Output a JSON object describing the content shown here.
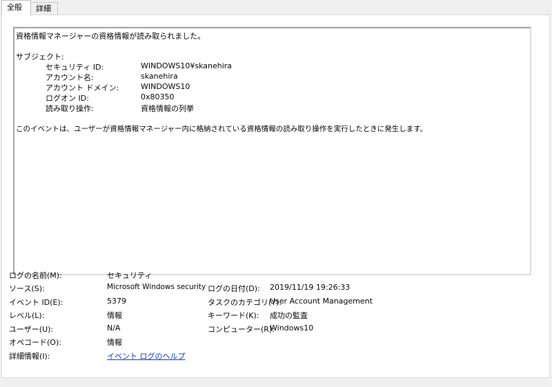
{
  "tabs": [
    {
      "label": "全般",
      "active": true
    },
    {
      "label": "詳細",
      "active": false
    }
  ],
  "description": {
    "headline": "資格情報マネージャーの資格情報が読み取られました。",
    "subject_heading": "サブジェクト:",
    "fields": [
      {
        "label": "セキュリティ ID:",
        "value": "WINDOWS10¥skanehira"
      },
      {
        "label": "アカウント名:",
        "value": "skanehira"
      },
      {
        "label": "アカウント ドメイン:",
        "value": "WINDOWS10"
      },
      {
        "label": "ログオン ID:",
        "value": "0x80350"
      },
      {
        "label": "読み取り操作:",
        "value": "資格情報の列挙"
      }
    ],
    "footer": "このイベントは、ユーザーが資格情報マネージャー内に格納されている資格情報の読み取り操作を実行したときに発生します。"
  },
  "meta_left": [
    {
      "label": "ログの名前(M):",
      "value": "セキュリティ"
    },
    {
      "label": "ソース(S):",
      "value": "Microsoft Windows security a"
    },
    {
      "label": "イベント ID(E):",
      "value": "5379"
    },
    {
      "label": "レベル(L):",
      "value": "情報"
    },
    {
      "label": "ユーザー(U):",
      "value": "N/A"
    },
    {
      "label": "オペコード(O):",
      "value": "情報"
    },
    {
      "label": "詳細情報(I):",
      "value": "イベント ログのヘルプ"
    }
  ],
  "meta_right": [
    {
      "label": "ログの日付(D):",
      "value": "2019/11/19 19:26:33"
    },
    {
      "label": "タスクのカテゴリ(Y):",
      "value": "User Account Management"
    },
    {
      "label": "キーワード(K):",
      "value": "成功の監査"
    },
    {
      "label": "コンピューター(R):",
      "value": "Windows10"
    }
  ],
  "colors": {
    "link": "#0033cc",
    "panel": "#ffffff",
    "window": "#f0f0f0"
  }
}
